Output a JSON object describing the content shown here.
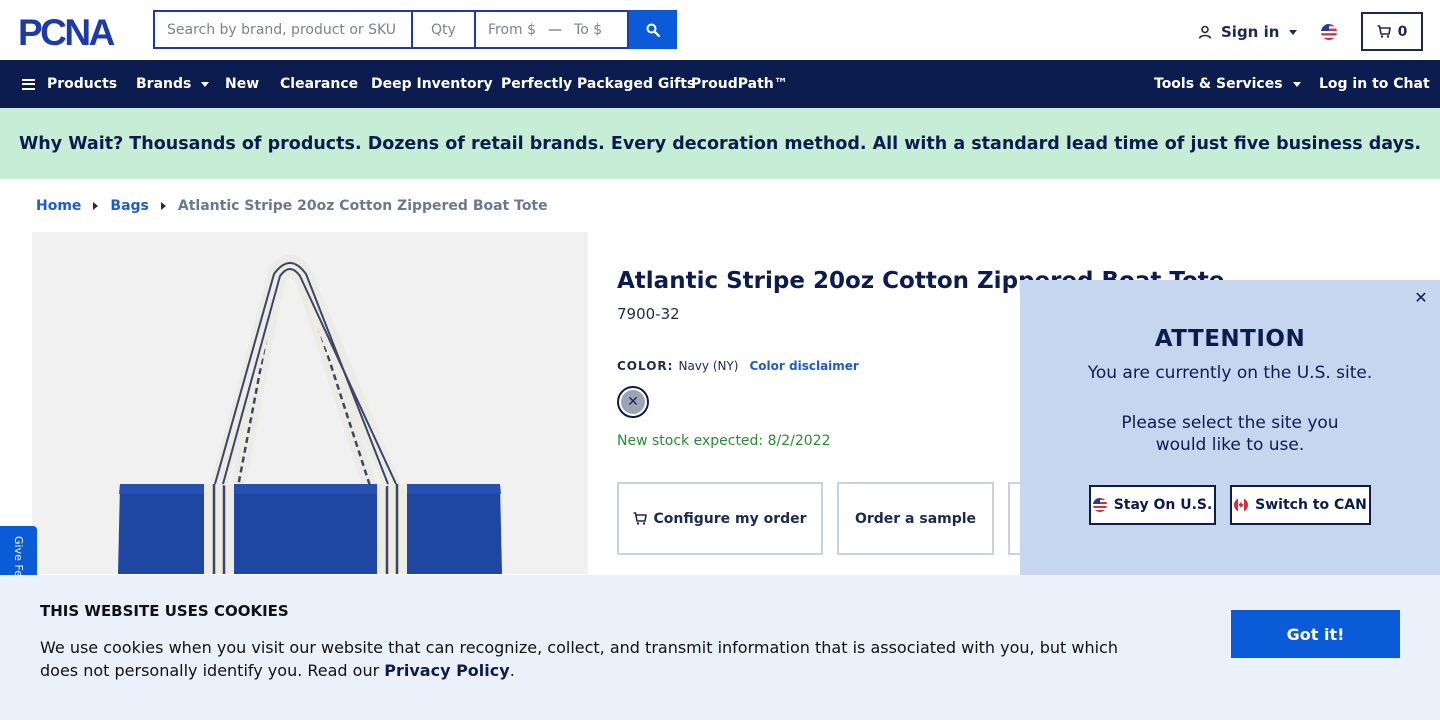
{
  "brand": {
    "logo_text": "PCNA",
    "color": "#1d3aa8"
  },
  "search": {
    "placeholder": "Search by brand, product or SKU",
    "qty_placeholder": "Qty",
    "from_placeholder": "From $",
    "to_placeholder": "To $",
    "icon": "search-icon"
  },
  "account": {
    "sign_in_label": "Sign in",
    "cart_count": "0",
    "region_flag": "us-flag-icon"
  },
  "nav": {
    "items": [
      {
        "label": "Products"
      },
      {
        "label": "Brands"
      },
      {
        "label": "New"
      },
      {
        "label": "Clearance"
      },
      {
        "label": "Deep Inventory"
      },
      {
        "label": "Perfectly Packaged Gifts"
      },
      {
        "label": "ProudPath™"
      },
      {
        "label": "Tools & Services"
      },
      {
        "label": "Log in to Chat"
      }
    ]
  },
  "promo": {
    "text": "Why Wait? Thousands of products. Dozens of retail brands. Every decoration method. All with a standard lead time of just five business days."
  },
  "breadcrumb": {
    "home": "Home",
    "category": "Bags",
    "current": "Atlantic Stripe 20oz Cotton Zippered Boat Tote"
  },
  "product": {
    "title": "Atlantic Stripe 20oz Cotton Zippered Boat Tote",
    "sku": "7900-32",
    "color_label": "COLOR:",
    "color_value": "Navy (NY)",
    "color_disclaimer": "Color disclaimer",
    "stock_text": "New stock expected: 8/2/2022",
    "configure_label": "Configure my order",
    "sample_label": "Order a sample"
  },
  "feedback": {
    "label": "Give Feedback"
  },
  "site_popup": {
    "title": "ATTENTION",
    "message1": "You are currently on the U.S. site.",
    "message2": "Please select the site you would like to use.",
    "stay_label": "Stay On U.S.",
    "switch_label": "Switch to CAN",
    "close_icon": "close-icon"
  },
  "cookie": {
    "title": "THIS WEBSITE USES COOKIES",
    "text_before": "We use cookies when you visit our website that can recognize, collect, and transmit information that is associated with you, but which does not personally identify you. Read our ",
    "privacy_link": "Privacy Policy",
    "text_after": ".",
    "button_label": "Got it!"
  },
  "colors": {
    "navy": "#0c1c4e",
    "primary_blue": "#0b5bd8",
    "promo_green": "#c6eed6",
    "popup_bg": "#c7d6ef",
    "stock_green": "#2a8a33"
  }
}
